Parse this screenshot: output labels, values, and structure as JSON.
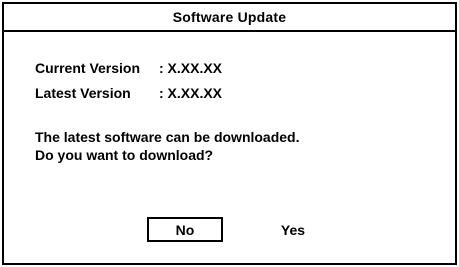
{
  "dialog": {
    "title": "Software Update",
    "current_version": {
      "label": "Current Version",
      "value": ": X.XX.XX"
    },
    "latest_version": {
      "label": "Latest Version",
      "value": ": X.XX.XX"
    },
    "message_line1": "The latest software can be downloaded.",
    "message_line2": "Do you want to download?",
    "buttons": {
      "no_label": "No",
      "yes_label": "Yes",
      "selected": "No"
    }
  }
}
